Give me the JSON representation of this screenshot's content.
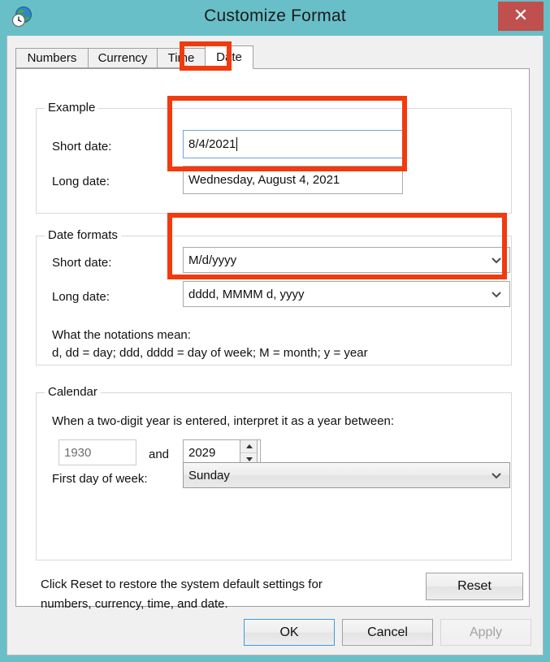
{
  "window": {
    "title": "Customize Format",
    "icon": "globe-clock-icon",
    "close_label": "✕",
    "frame_color": "#68bfc8",
    "close_color": "#c0504d",
    "annotation_color": "#f23a0f"
  },
  "tabs": [
    {
      "label": "Numbers",
      "active": false
    },
    {
      "label": "Currency",
      "active": false
    },
    {
      "label": "Time",
      "active": false
    },
    {
      "label": "Date",
      "active": true
    }
  ],
  "example": {
    "group_title": "Example",
    "short_date_label": "Short date:",
    "short_date_value": "8/4/2021",
    "long_date_label": "Long date:",
    "long_date_value": "Wednesday, August 4, 2021"
  },
  "date_formats": {
    "group_title": "Date formats",
    "short_date_label": "Short date:",
    "short_date_value": "M/d/yyyy",
    "long_date_label": "Long date:",
    "long_date_value": "dddd, MMMM d, yyyy",
    "notations_heading": "What the notations mean:",
    "notations_line": "d, dd = day;  ddd, dddd = day of week;  M = month;  y = year"
  },
  "calendar": {
    "group_title": "Calendar",
    "two_digit_year_text": "When a two-digit year is entered, interpret it as a year between:",
    "year_from": "1930",
    "and_label": "and",
    "year_to": "2029",
    "first_day_label": "First day of week:",
    "first_day_value": "Sunday"
  },
  "reset": {
    "description_line1": "Click Reset to restore the system default settings for",
    "description_line2": "numbers, currency, time, and date.",
    "button_label": "Reset"
  },
  "footer": {
    "ok_label": "OK",
    "cancel_label": "Cancel",
    "apply_label": "Apply"
  }
}
